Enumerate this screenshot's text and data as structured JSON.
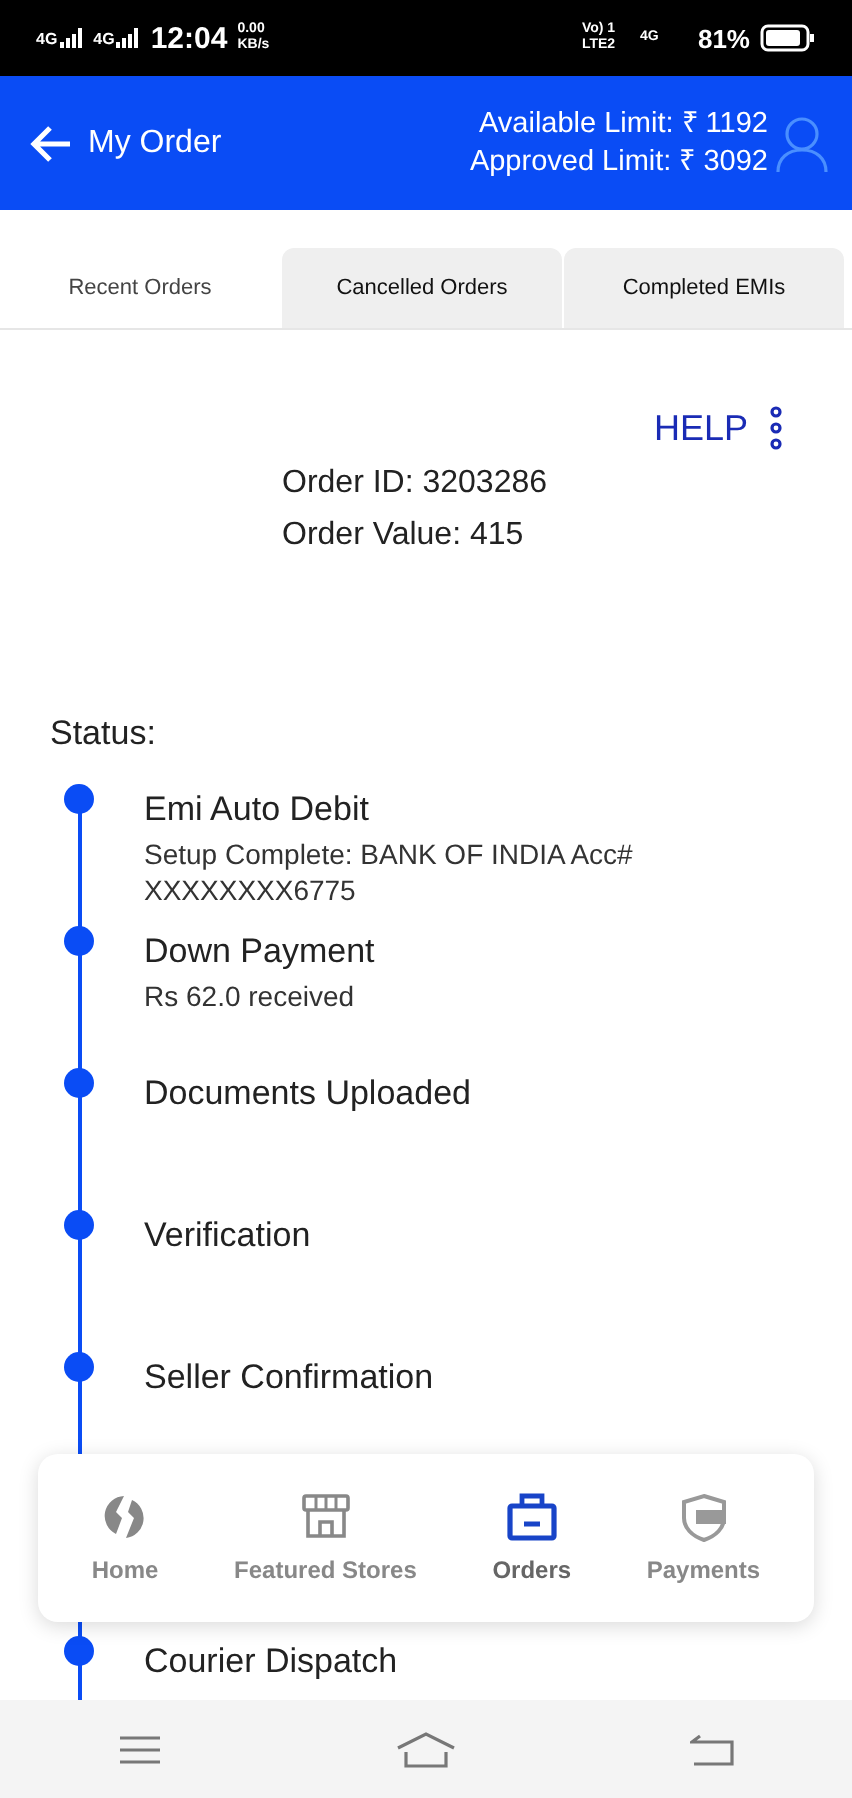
{
  "status_bar": {
    "sim_labels": [
      "4G",
      "4G"
    ],
    "time": "12:04",
    "speed": "0.00 KB/s",
    "network": "Vo) 1 LTE2",
    "data": "4G",
    "battery": "81%"
  },
  "header": {
    "title": "My Order",
    "available_limit": "Available Limit:  ₹ 1192",
    "approved_limit": "Approved Limit: ₹ 3092"
  },
  "tabs": [
    {
      "label": "Recent Orders",
      "selected": true
    },
    {
      "label": "Cancelled Orders",
      "selected": false
    },
    {
      "label": "Completed EMIs",
      "selected": false
    }
  ],
  "help": "HELP",
  "order": {
    "id": "Order ID: 3203286",
    "value": "Order Value: 415"
  },
  "status_label": "Status:",
  "steps": [
    {
      "title": "Emi Auto Debit",
      "detail": "Setup Complete: BANK OF INDIA Acc# XXXXXXXX6775"
    },
    {
      "title": "Down Payment",
      "detail": "Rs 62.0 received"
    },
    {
      "title": "Documents Uploaded"
    },
    {
      "title": "Verification"
    },
    {
      "title": "Seller Confirmation"
    },
    {
      "title": "Courier Dispatch"
    }
  ],
  "bottom_nav": [
    {
      "label": "Home",
      "selected": false
    },
    {
      "label": "Featured Stores",
      "selected": false
    },
    {
      "label": "Orders",
      "selected": true
    },
    {
      "label": "Payments",
      "selected": false
    }
  ]
}
